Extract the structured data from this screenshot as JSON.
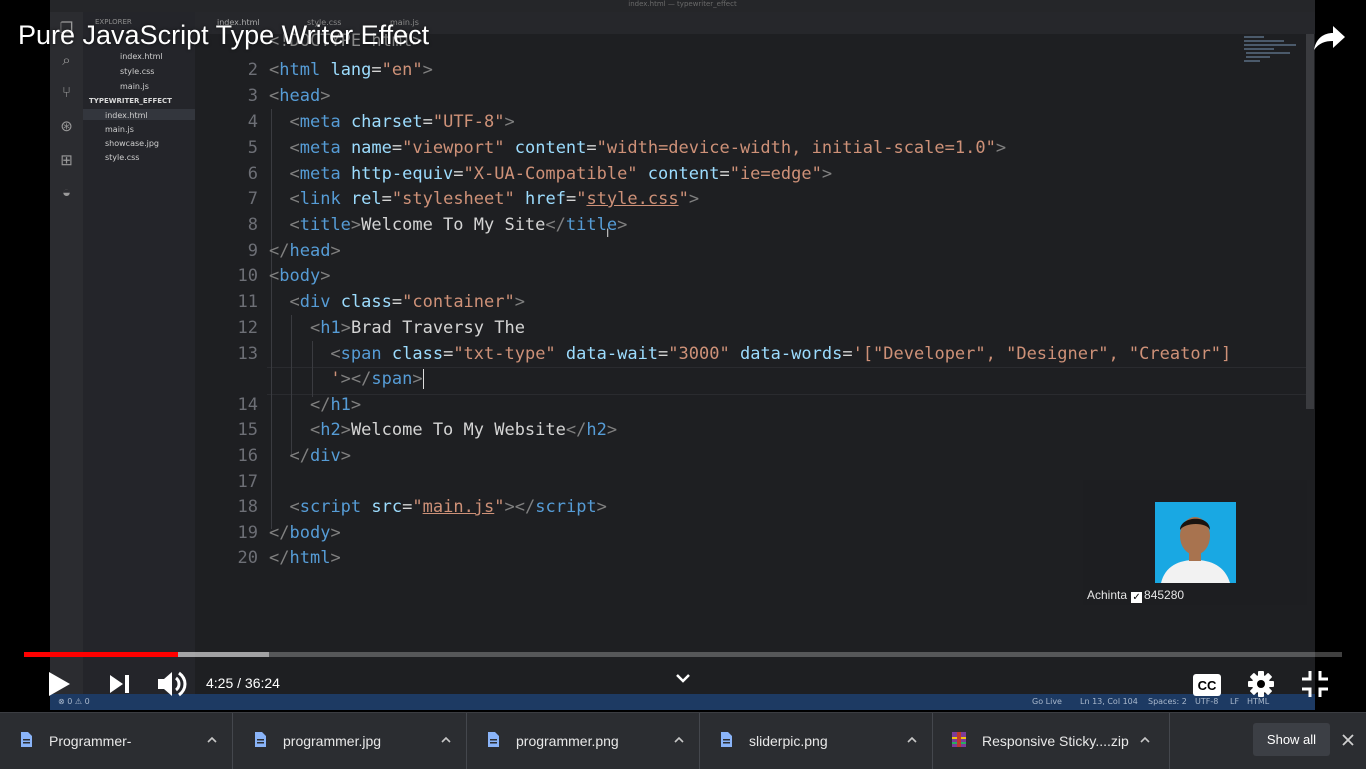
{
  "video": {
    "title": "Pure JavaScript Type Writer Effect",
    "progress_fraction": 0.1167,
    "buffered_fraction": 0.186,
    "time_current": "4:25",
    "time_separator": " / ",
    "time_total": "36:24"
  },
  "editor": {
    "window_title": "index.html — typewriter_effect",
    "tabs": [
      "index.html",
      "style.css",
      "main.js"
    ],
    "explorer_label": "EXPLORER",
    "open_editors": [
      "index.html",
      "style.css",
      "main.js"
    ],
    "folder_name": "TYPEWRITER_EFFECT",
    "files": [
      "index.html",
      "main.js",
      "showcase.jpg",
      "style.css"
    ],
    "line_numbers": [
      "2",
      "3",
      "4",
      "5",
      "6",
      "7",
      "8",
      "9",
      "10",
      "11",
      "12",
      "13",
      "",
      "14",
      "15",
      "16",
      "17",
      "18",
      "19",
      "20"
    ],
    "partial_first_line": "<!DOCTYPE html>",
    "status_left": "⊗ 0 ⚠ 0",
    "status_right": [
      "Go Live",
      "Ln 13, Col 104",
      "Spaces: 2",
      "UTF-8",
      "LF",
      "HTML"
    ]
  },
  "webcam": {
    "name": "Achinta",
    "count": "845280"
  },
  "downloads": {
    "items": [
      {
        "name": "Programmer-"
      },
      {
        "name": "programmer.jpg"
      },
      {
        "name": "programmer.png"
      },
      {
        "name": "sliderpic.png"
      },
      {
        "name": "Responsive Sticky....zip"
      }
    ],
    "show_all_label": "Show all"
  },
  "colors": {
    "accent": "#ff0000",
    "tag": "#569cd6",
    "attribute": "#9cdcfe",
    "string": "#ce9178",
    "statusbar": "#1d3a63"
  }
}
